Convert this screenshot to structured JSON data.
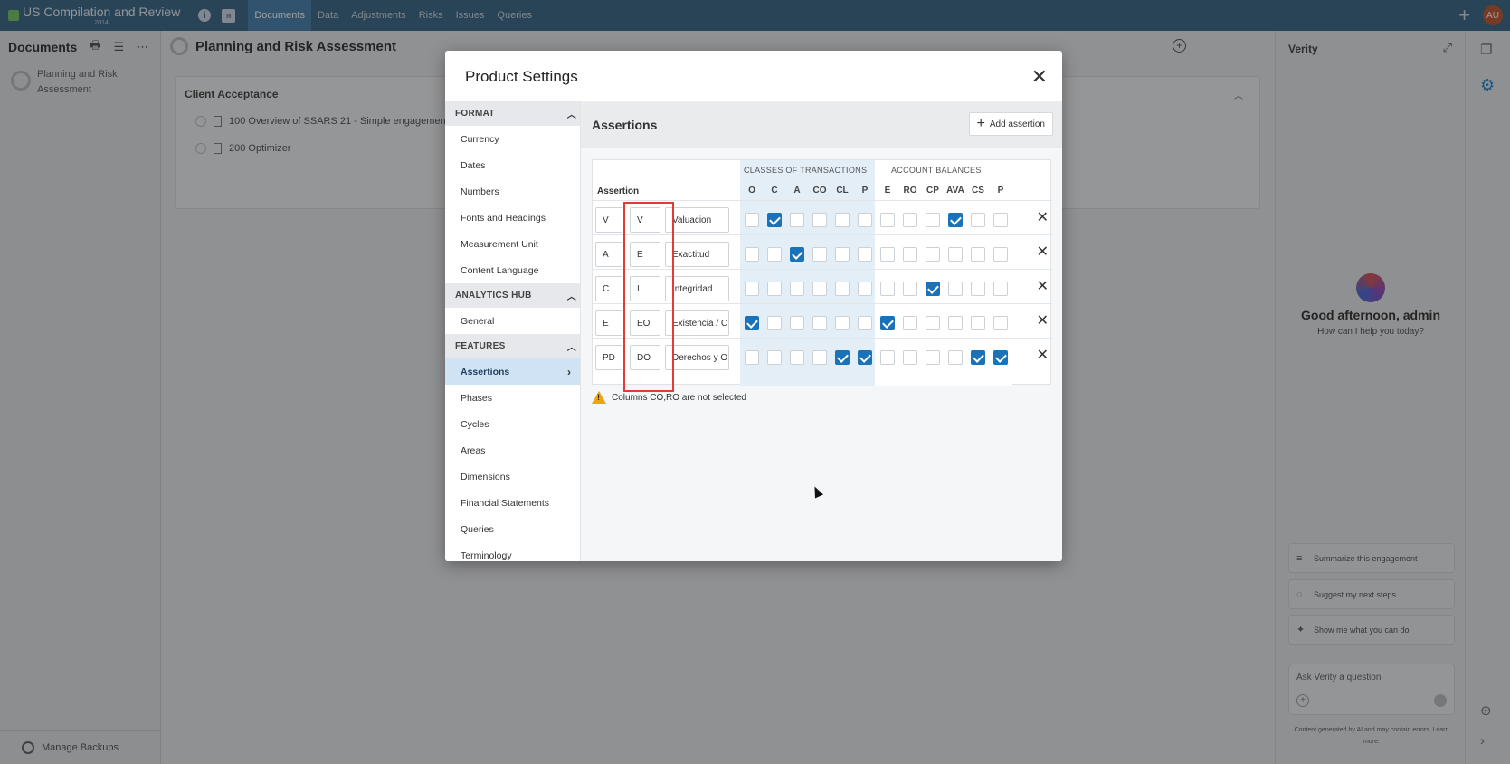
{
  "app": {
    "title": "US Compilation and Review",
    "subtitle": "2014",
    "nav": [
      "Documents",
      "Data",
      "Adjustments",
      "Risks",
      "Issues",
      "Queries"
    ],
    "active_nav": "Documents",
    "user_initials": "AU"
  },
  "sidebar": {
    "title": "Documents",
    "doc_label": "Planning and Risk Assessment",
    "footer": "Manage Backups"
  },
  "main": {
    "page_title": "Planning and Risk Assessment",
    "card_title": "Client Acceptance",
    "rows": [
      "100 Overview of SSARS 21 - Simple engagement",
      "200 Optimizer"
    ]
  },
  "verity": {
    "title": "Verity",
    "greeting": "Good afternoon, admin",
    "help": "How can I help you today?",
    "suggestions": [
      "Summarize this engagement",
      "Suggest my next steps",
      "Show me what you can do"
    ],
    "ask_placeholder": "Ask Verity a question",
    "disclaimer": "Content generated by AI and may contain errors. Learn more."
  },
  "modal": {
    "title": "Product Settings",
    "nav": {
      "format_label": "FORMAT",
      "format_items": [
        "Currency",
        "Dates",
        "Numbers",
        "Fonts and Headings",
        "Measurement Unit",
        "Content Language"
      ],
      "analytics_label": "ANALYTICS HUB",
      "analytics_items": [
        "General"
      ],
      "features_label": "FEATURES",
      "features_items": [
        "Assertions",
        "Phases",
        "Cycles",
        "Areas",
        "Dimensions",
        "Financial Statements",
        "Queries",
        "Terminology"
      ],
      "active": "Assertions"
    },
    "content": {
      "title": "Assertions",
      "add_label": "Add assertion",
      "group_ct": "CLASSES OF TRANSACTIONS",
      "group_ab": "ACCOUNT BALANCES",
      "assertion_label": "Assertion",
      "columns": [
        "O",
        "C",
        "A",
        "CO",
        "CL",
        "P",
        "E",
        "RO",
        "CP",
        "AVA",
        "CS",
        "P"
      ],
      "rows": [
        {
          "code": "V",
          "alt": "V",
          "name": "Valuacion",
          "checks": [
            0,
            1,
            0,
            0,
            0,
            0,
            0,
            0,
            0,
            1,
            0,
            0
          ]
        },
        {
          "code": "A",
          "alt": "E",
          "name": "Exactitud",
          "checks": [
            0,
            0,
            1,
            0,
            0,
            0,
            0,
            0,
            0,
            0,
            0,
            0
          ]
        },
        {
          "code": "C",
          "alt": "I",
          "name": "Integridad",
          "checks": [
            0,
            0,
            0,
            0,
            0,
            0,
            0,
            0,
            1,
            0,
            0,
            0
          ]
        },
        {
          "code": "E",
          "alt": "EO",
          "name": "Existencia / C",
          "checks": [
            1,
            0,
            0,
            0,
            0,
            0,
            1,
            0,
            0,
            0,
            0,
            0
          ]
        },
        {
          "code": "PD",
          "alt": "DO",
          "name": "Derechos y O",
          "checks": [
            0,
            0,
            0,
            0,
            1,
            1,
            0,
            0,
            0,
            0,
            1,
            1
          ]
        }
      ],
      "warning": "Columns CO,RO are not selected"
    }
  }
}
